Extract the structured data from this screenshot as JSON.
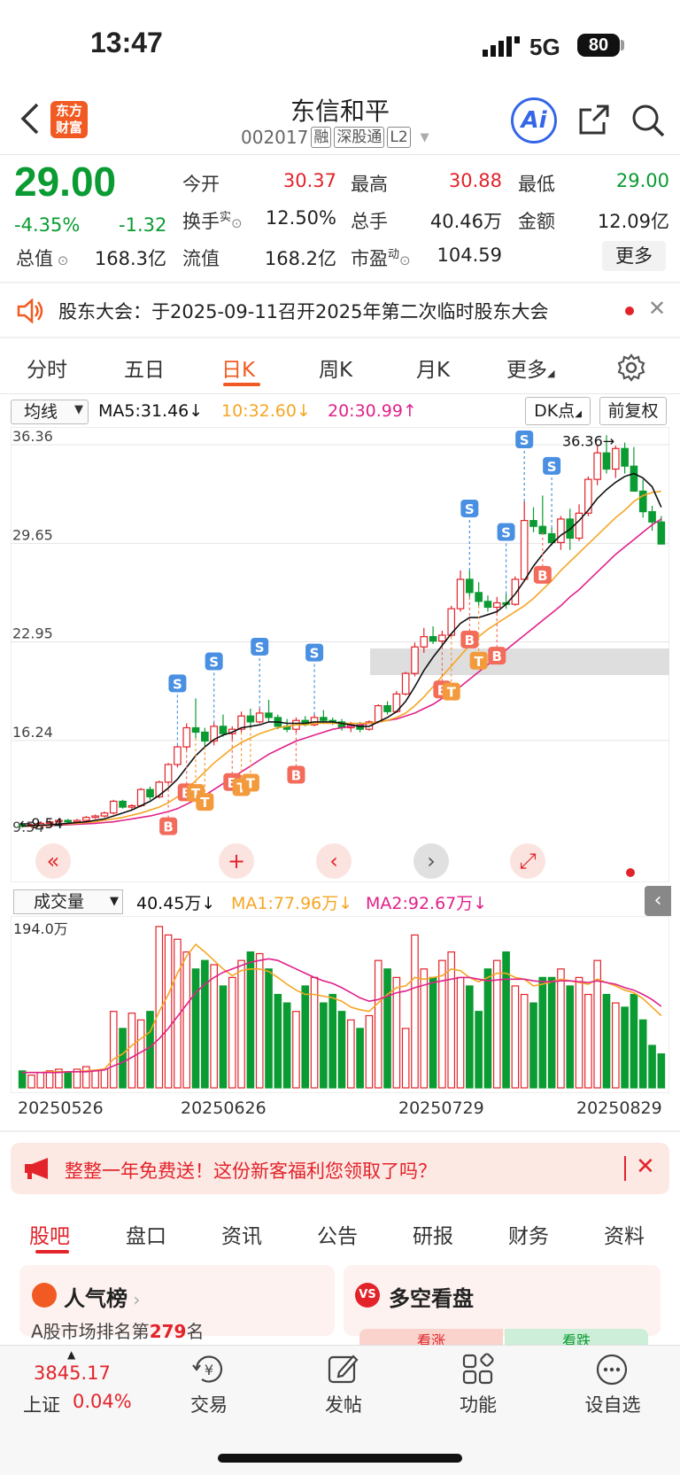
{
  "status_bar": {
    "time": "13:47",
    "network": "5G",
    "battery": "80"
  },
  "header": {
    "title": "东信和平",
    "code": "002017",
    "tags": [
      "融",
      "深股通",
      "L2"
    ],
    "logo_text": [
      "东方",
      "财富"
    ],
    "ai_label": "Ai"
  },
  "quote": {
    "price": "29.00",
    "change_pct": "-4.35%",
    "change": "-1.32",
    "fields": [
      {
        "label": "今开",
        "value": "30.37",
        "color": "red"
      },
      {
        "label": "最高",
        "value": "30.88",
        "color": "red"
      },
      {
        "label": "最低",
        "value": "29.00",
        "color": "green"
      },
      {
        "label": "换手",
        "sup": "实",
        "value": "12.50%",
        "color": "black"
      },
      {
        "label": "总手",
        "value": "40.46万",
        "color": "black"
      },
      {
        "label": "金额",
        "value": "12.09亿",
        "color": "black"
      },
      {
        "label": "总值",
        "value": "168.3亿",
        "color": "black"
      },
      {
        "label": "流值",
        "value": "168.2亿",
        "color": "black"
      },
      {
        "label": "市盈",
        "sup": "动",
        "value": "104.59",
        "color": "black"
      }
    ],
    "more_label": "更多"
  },
  "notice": {
    "text": "股东大会：于2025-09-11召开2025年第二次临时股东大会"
  },
  "chart_tabs": [
    "分时",
    "五日",
    "日K",
    "周K",
    "月K",
    "更多"
  ],
  "ma_bar": {
    "selector": "均线",
    "ma5": "MA5:31.46",
    "ma10": "10:32.60",
    "ma20": "20:30.99",
    "dk_label": "DK点",
    "adjust_label": "前复权"
  },
  "colors": {
    "up": "#e2232a",
    "down": "#0a9b32",
    "ma5": "#111111",
    "ma10": "#f5a623",
    "ma20": "#e0218a",
    "accent": "#f15a22"
  },
  "chart_data": [
    {
      "type": "candlestick",
      "y_ticks": [
        "36.36",
        "29.65",
        "22.95",
        "16.24",
        "9.54"
      ],
      "ylim": [
        9.54,
        36.36
      ],
      "annotations": [
        "36.36",
        "9.54"
      ],
      "x_labels": [
        "20250526",
        "20250626",
        "20250729",
        "20250829"
      ],
      "ohlc": [
        [
          9.9,
          10.0,
          9.7,
          9.8
        ],
        [
          9.8,
          10.0,
          9.7,
          9.9
        ],
        [
          9.9,
          10.1,
          9.8,
          10.0
        ],
        [
          10.0,
          10.2,
          9.9,
          10.1
        ],
        [
          10.1,
          10.3,
          10.0,
          10.2
        ],
        [
          10.2,
          10.3,
          10.0,
          10.1
        ],
        [
          10.1,
          10.3,
          10.0,
          10.2
        ],
        [
          10.2,
          10.5,
          10.1,
          10.4
        ],
        [
          10.4,
          10.6,
          10.3,
          10.5
        ],
        [
          10.5,
          10.8,
          10.4,
          10.7
        ],
        [
          10.7,
          11.6,
          10.6,
          11.5
        ],
        [
          11.5,
          11.6,
          11.0,
          11.1
        ],
        [
          11.1,
          11.3,
          10.9,
          11.2
        ],
        [
          11.2,
          12.4,
          11.1,
          12.3
        ],
        [
          12.3,
          12.5,
          11.6,
          11.8
        ],
        [
          11.8,
          12.9,
          11.7,
          12.8
        ],
        [
          12.8,
          14.1,
          12.7,
          14.0
        ],
        [
          14.0,
          15.3,
          13.8,
          15.2
        ],
        [
          15.2,
          16.8,
          15.0,
          16.5
        ],
        [
          16.5,
          18.5,
          15.8,
          16.2
        ],
        [
          16.2,
          16.5,
          15.2,
          15.6
        ],
        [
          15.6,
          16.8,
          15.3,
          16.6
        ],
        [
          16.6,
          17.4,
          15.9,
          16.1
        ],
        [
          16.1,
          16.6,
          15.7,
          16.4
        ],
        [
          16.4,
          17.6,
          16.2,
          17.3
        ],
        [
          17.3,
          17.8,
          16.5,
          16.9
        ],
        [
          16.9,
          17.8,
          16.8,
          17.5
        ],
        [
          17.5,
          18.4,
          16.9,
          17.2
        ],
        [
          17.2,
          17.4,
          16.4,
          16.6
        ],
        [
          16.6,
          17.1,
          16.2,
          16.4
        ],
        [
          16.4,
          17.2,
          16.2,
          17.0
        ],
        [
          17.0,
          17.3,
          16.6,
          16.7
        ],
        [
          16.7,
          17.4,
          16.6,
          17.2
        ],
        [
          17.2,
          17.7,
          16.8,
          17.0
        ],
        [
          17.0,
          17.2,
          16.7,
          16.9
        ],
        [
          16.9,
          17.1,
          16.3,
          16.5
        ],
        [
          16.5,
          16.9,
          16.2,
          16.7
        ],
        [
          16.7,
          16.9,
          16.2,
          16.4
        ],
        [
          16.4,
          17.0,
          16.3,
          16.9
        ],
        [
          16.9,
          18.1,
          16.8,
          18.0
        ],
        [
          18.0,
          18.3,
          17.4,
          17.6
        ],
        [
          17.6,
          19.0,
          17.5,
          18.8
        ],
        [
          18.8,
          20.3,
          18.7,
          20.2
        ],
        [
          20.2,
          22.3,
          20.0,
          22.0
        ],
        [
          22.0,
          23.3,
          21.6,
          22.7
        ],
        [
          22.7,
          23.4,
          22.2,
          22.4
        ],
        [
          22.4,
          23.1,
          22.0,
          22.8
        ],
        [
          22.8,
          24.8,
          22.7,
          24.6
        ],
        [
          24.6,
          27.2,
          24.4,
          26.6
        ],
        [
          26.6,
          27.2,
          25.4,
          25.7
        ],
        [
          25.7,
          26.4,
          24.8,
          25.1
        ],
        [
          25.1,
          25.5,
          24.4,
          24.7
        ],
        [
          24.7,
          25.4,
          24.3,
          25.0
        ],
        [
          25.0,
          25.6,
          24.6,
          24.9
        ],
        [
          24.9,
          26.8,
          24.8,
          26.6
        ],
        [
          26.6,
          31.9,
          26.5,
          30.6
        ],
        [
          30.6,
          31.5,
          29.8,
          30.2
        ],
        [
          30.2,
          32.3,
          29.8,
          29.7
        ],
        [
          29.7,
          30.1,
          28.9,
          29.1
        ],
        [
          29.1,
          30.9,
          28.6,
          30.7
        ],
        [
          30.7,
          31.4,
          28.6,
          29.4
        ],
        [
          29.4,
          31.7,
          29.2,
          31.1
        ],
        [
          31.1,
          33.6,
          30.9,
          33.4
        ],
        [
          33.4,
          35.7,
          33.0,
          35.2
        ],
        [
          35.2,
          36.4,
          33.8,
          34.1
        ],
        [
          34.1,
          35.7,
          33.5,
          35.5
        ],
        [
          35.5,
          35.9,
          33.8,
          34.3
        ],
        [
          34.3,
          35.6,
          32.9,
          32.6
        ],
        [
          32.6,
          33.4,
          30.8,
          31.2
        ],
        [
          31.2,
          31.6,
          29.9,
          30.5
        ],
        [
          30.5,
          30.9,
          29.0,
          29.0
        ]
      ],
      "ma5": [
        9.8,
        9.85,
        9.87,
        9.9,
        9.95,
        10.0,
        10.05,
        10.1,
        10.2,
        10.3,
        10.5,
        10.7,
        10.9,
        11.2,
        11.5,
        11.9,
        12.4,
        13.0,
        13.8,
        14.6,
        15.2,
        15.7,
        16.0,
        16.2,
        16.5,
        16.6,
        16.7,
        16.9,
        16.9,
        16.8,
        16.8,
        16.8,
        16.9,
        16.9,
        16.9,
        16.8,
        16.7,
        16.6,
        16.6,
        16.9,
        17.2,
        17.6,
        18.3,
        19.3,
        20.4,
        21.3,
        22.1,
        22.9,
        23.6,
        24.0,
        24.0,
        24.2,
        24.4,
        24.9,
        25.6,
        26.5,
        27.5,
        28.3,
        29.0,
        29.6,
        30.0,
        30.6,
        31.3,
        32.1,
        32.7,
        33.2,
        33.6,
        33.8,
        33.5,
        32.9,
        31.5
      ],
      "ma10": [
        9.8,
        9.82,
        9.85,
        9.88,
        9.92,
        9.96,
        10.0,
        10.05,
        10.1,
        10.2,
        10.3,
        10.4,
        10.55,
        10.7,
        10.9,
        11.1,
        11.4,
        11.8,
        12.3,
        12.9,
        13.5,
        14.1,
        14.6,
        15.1,
        15.5,
        15.8,
        16.1,
        16.3,
        16.5,
        16.6,
        16.7,
        16.7,
        16.8,
        16.8,
        16.8,
        16.8,
        16.8,
        16.8,
        16.8,
        16.9,
        17.0,
        17.2,
        17.5,
        18.0,
        18.6,
        19.3,
        20.0,
        20.7,
        21.4,
        22.1,
        22.7,
        23.2,
        23.6,
        24.0,
        24.4,
        24.8,
        25.3,
        25.9,
        26.5,
        27.2,
        27.8,
        28.4,
        29.0,
        29.6,
        30.2,
        30.8,
        31.3,
        31.9,
        32.3,
        32.5,
        32.6
      ],
      "ma20": [
        9.8,
        9.81,
        9.83,
        9.85,
        9.87,
        9.9,
        9.93,
        9.96,
        10.0,
        10.05,
        10.1,
        10.2,
        10.3,
        10.4,
        10.5,
        10.65,
        10.8,
        11.0,
        11.3,
        11.6,
        11.9,
        12.3,
        12.7,
        13.1,
        13.5,
        13.9,
        14.3,
        14.7,
        15.0,
        15.3,
        15.6,
        15.8,
        16.0,
        16.2,
        16.4,
        16.5,
        16.6,
        16.7,
        16.8,
        16.9,
        17.0,
        17.1,
        17.3,
        17.5,
        17.8,
        18.1,
        18.5,
        18.9,
        19.3,
        19.8,
        20.3,
        20.8,
        21.3,
        21.8,
        22.3,
        22.8,
        23.3,
        23.8,
        24.3,
        24.8,
        25.4,
        25.9,
        26.5,
        27.1,
        27.7,
        28.3,
        28.8,
        29.3,
        29.8,
        30.3,
        30.7
      ],
      "signals": [
        {
          "i": 17,
          "t": "S"
        },
        {
          "i": 21,
          "t": "S"
        },
        {
          "i": 26,
          "t": "S"
        },
        {
          "i": 32,
          "t": "S"
        },
        {
          "i": 49,
          "t": "S"
        },
        {
          "i": 53,
          "t": "S"
        },
        {
          "i": 55,
          "t": "S"
        },
        {
          "i": 58,
          "t": "S"
        },
        {
          "i": 16,
          "t": "B"
        },
        {
          "i": 18,
          "t": "B"
        },
        {
          "i": 23,
          "t": "B"
        },
        {
          "i": 30,
          "t": "B"
        },
        {
          "i": 46,
          "t": "B"
        },
        {
          "i": 49,
          "t": "B"
        },
        {
          "i": 52,
          "t": "B"
        },
        {
          "i": 57,
          "t": "B"
        },
        {
          "i": 19,
          "t": "T"
        },
        {
          "i": 20,
          "t": "T"
        },
        {
          "i": 24,
          "t": "T"
        },
        {
          "i": 25,
          "t": "T"
        },
        {
          "i": 47,
          "t": "T"
        },
        {
          "i": 50,
          "t": "T"
        }
      ]
    },
    {
      "type": "bar",
      "ylabel": "194.0万",
      "ylim": [
        0,
        194
      ],
      "values": [
        20,
        15,
        18,
        20,
        22,
        18,
        22,
        25,
        20,
        22,
        90,
        70,
        88,
        80,
        90,
        190,
        180,
        175,
        160,
        140,
        150,
        145,
        120,
        130,
        150,
        160,
        158,
        140,
        110,
        100,
        90,
        120,
        130,
        100,
        110,
        90,
        80,
        70,
        85,
        150,
        140,
        130,
        70,
        180,
        140,
        130,
        150,
        160,
        130,
        120,
        90,
        140,
        150,
        160,
        120,
        110,
        100,
        130,
        130,
        140,
        120,
        130,
        110,
        150,
        110,
        100,
        95,
        110,
        80,
        50,
        40
      ],
      "ma1": [
        18,
        18,
        18,
        19,
        19,
        19,
        19,
        20,
        21,
        22,
        34,
        40,
        50,
        58,
        66,
        90,
        110,
        135,
        155,
        169,
        160,
        150,
        140,
        132,
        138,
        140,
        140,
        137,
        130,
        122,
        115,
        110,
        110,
        108,
        106,
        102,
        95,
        92,
        90,
        100,
        110,
        118,
        120,
        130,
        128,
        130,
        132,
        140,
        138,
        130,
        125,
        130,
        135,
        135,
        130,
        128,
        120,
        122,
        125,
        128,
        126,
        124,
        122,
        128,
        124,
        120,
        115,
        112,
        105,
        95,
        85
      ],
      "ma2": [
        18,
        18,
        18,
        18,
        18,
        19,
        19,
        19,
        20,
        21,
        26,
        30,
        36,
        42,
        48,
        58,
        70,
        84,
        98,
        112,
        122,
        130,
        136,
        140,
        144,
        148,
        150,
        152,
        150,
        145,
        140,
        135,
        130,
        126,
        123,
        118,
        112,
        106,
        102,
        104,
        108,
        112,
        114,
        118,
        121,
        124,
        126,
        128,
        130,
        130,
        128,
        126,
        127,
        128,
        128,
        128,
        126,
        125,
        125,
        126,
        126,
        125,
        124,
        126,
        124,
        122,
        118,
        115,
        110,
        104,
        96
      ]
    }
  ],
  "volume_bar": {
    "selector": "成交量",
    "vol": "40.45万",
    "ma1": "MA1:77.96万",
    "ma2": "MA2:92.67万"
  },
  "promo": {
    "text": "整整一年免费送！这份新客福利您领取了吗？"
  },
  "bottom_tabs": [
    "股吧",
    "盘口",
    "资讯",
    "公告",
    "研报",
    "财务",
    "资料"
  ],
  "cards": {
    "popularity": {
      "title": "人气榜",
      "subtitle_prefix": "A股市场排名第",
      "rank": "279",
      "subtitle_suffix": "名"
    },
    "sentiment": {
      "title": "多空看盘",
      "badge": "VS",
      "bull": "看涨",
      "bear": "看跌"
    }
  },
  "bottom_nav": {
    "index_value": "3845.17",
    "index_name": "上证",
    "index_pct": "0.04%",
    "items": [
      "交易",
      "发帖",
      "功能",
      "设自选"
    ]
  }
}
